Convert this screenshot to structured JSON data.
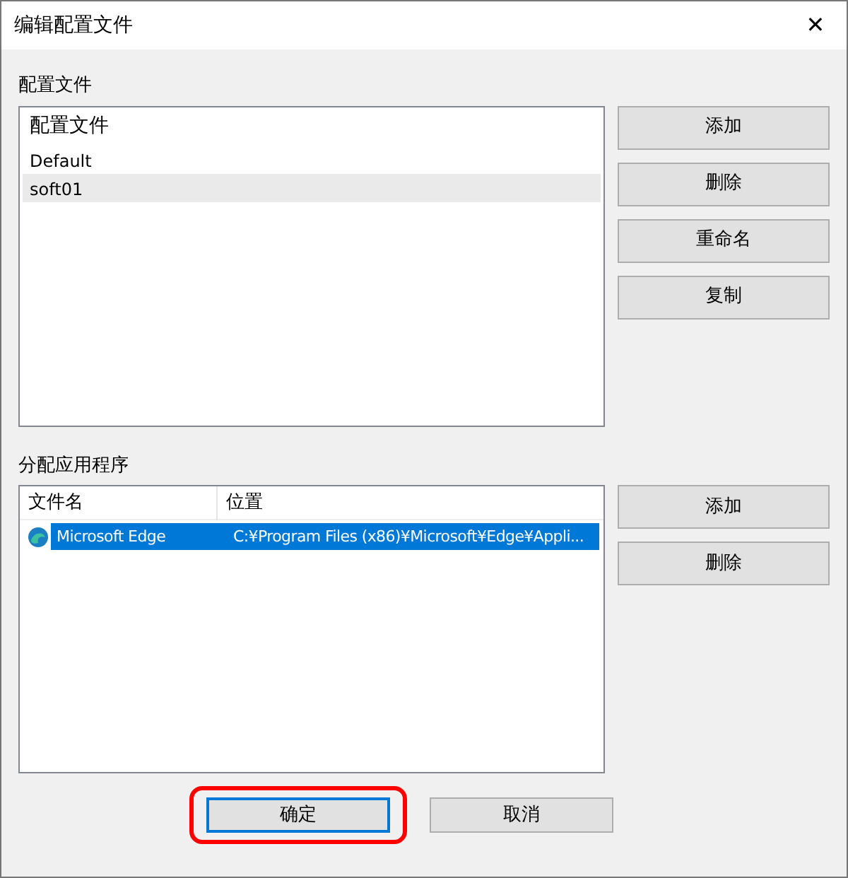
{
  "window": {
    "title": "编辑配置文件",
    "close": "✕"
  },
  "profiles": {
    "label": "配置文件",
    "header": "配置文件",
    "items": [
      {
        "name": "Default",
        "selected": false
      },
      {
        "name": "soft01",
        "selected": true
      }
    ],
    "buttons": [
      "添加",
      "删除",
      "重命名",
      "复制"
    ]
  },
  "apps": {
    "label": "分配应用程序",
    "columns": [
      "文件名",
      "位置"
    ],
    "rows": [
      {
        "name": "Microsoft Edge",
        "location": "C:¥Program Files (x86)¥Microsoft¥Edge¥Appli...",
        "selected": true
      }
    ],
    "buttons": [
      "添加",
      "删除"
    ]
  },
  "footer": [
    {
      "label": "确定",
      "default": true,
      "highlighted": true
    },
    {
      "label": "取消",
      "default": false,
      "highlighted": false
    }
  ]
}
